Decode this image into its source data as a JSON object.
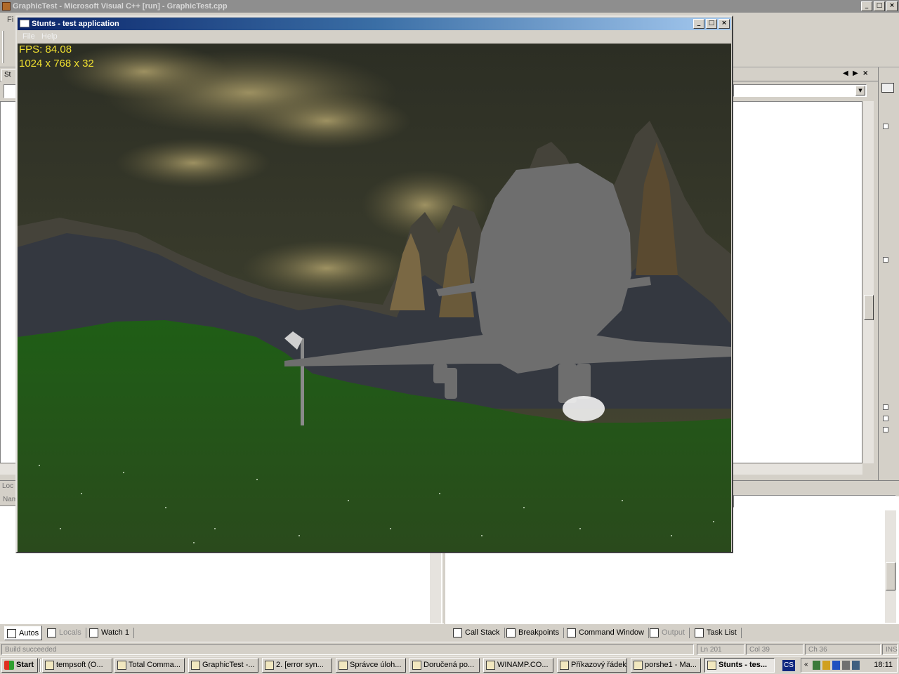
{
  "ide": {
    "title": "GraphicTest - Microsoft Visual C++ [run] - GraphicTest.cpp",
    "menu_first": "Fi",
    "editor_tab_first": "St",
    "bottom_left_header": "Loc",
    "bottom_left_column": "Nam"
  },
  "left_tabs": [
    {
      "label": "Autos"
    },
    {
      "label": "Locals"
    },
    {
      "label": "Watch 1"
    }
  ],
  "right_tabs": [
    {
      "label": "Call Stack"
    },
    {
      "label": "Breakpoints"
    },
    {
      "label": "Command Window"
    },
    {
      "label": "Output"
    },
    {
      "label": "Task List"
    }
  ],
  "statusbar": {
    "message": "Build succeeded",
    "ln": "Ln 201",
    "col": "Col 39",
    "ch": "Ch 36",
    "ins": "INS"
  },
  "stunts": {
    "title": "Stunts - test application",
    "menu": [
      "File",
      "Help"
    ],
    "fps": "FPS: 84.08",
    "resolution": "1024 x 768 x 32"
  },
  "taskbar": {
    "start_label": "Start",
    "items": [
      {
        "label": "tempsoft (O..."
      },
      {
        "label": "Total Comma..."
      },
      {
        "label": "GraphicTest -..."
      },
      {
        "label": "2. [error syn..."
      },
      {
        "label": "Správce úloh..."
      },
      {
        "label": "Doručená po..."
      },
      {
        "label": "WINAMP.CO..."
      },
      {
        "label": "Příkazový řádek"
      },
      {
        "label": "porshe1 - Ma..."
      },
      {
        "label": "Stunts - tes..."
      }
    ],
    "lang": "CS",
    "clock": "18:11"
  },
  "colors": {
    "hud_text": "#f0e030",
    "titlebar_active_start": "#0a246a",
    "titlebar_active_end": "#a6caf0",
    "grass": "#1e5a14",
    "aircraft": "#6e6e6e"
  },
  "icons": {
    "window_controls": [
      "minimize-icon",
      "maximize-icon",
      "close-icon"
    ],
    "tray": [
      "network-icon",
      "volume-icon",
      "shield-icon"
    ]
  }
}
